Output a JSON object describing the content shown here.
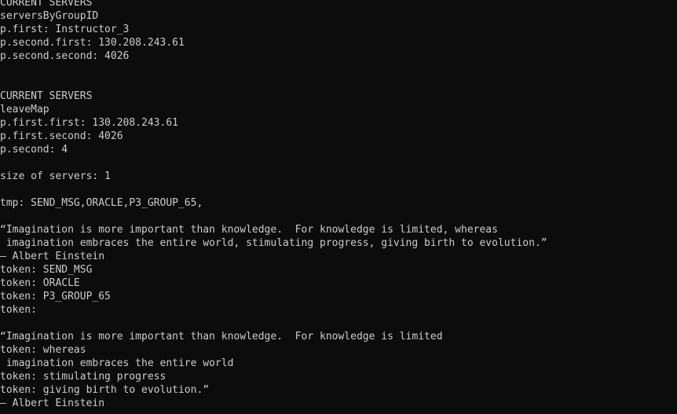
{
  "console": {
    "lines": [
      "CURRENT SERVERS",
      "serversByGroupID",
      "p.first: Instructor_3",
      "p.second.first: 130.208.243.61",
      "p.second.second: 4026",
      "",
      "",
      "CURRENT SERVERS",
      "leaveMap",
      "p.first.first: 130.208.243.61",
      "p.first.second: 4026",
      "p.second: 4",
      "",
      "size of servers: 1",
      "",
      "tmp: SEND_MSG,ORACLE,P3_GROUP_65,",
      "",
      "“Imagination is more important than knowledge.  For knowledge is limited, whereas",
      " imagination embraces the entire world, stimulating progress, giving birth to evolution.”",
      "— Albert Einstein",
      "token: SEND_MSG",
      "token: ORACLE",
      "token: P3_GROUP_65",
      "token: ",
      "",
      "“Imagination is more important than knowledge.  For knowledge is limited",
      "token: whereas",
      " imagination embraces the entire world",
      "token: stimulating progress",
      "token: giving birth to evolution.”",
      "— Albert Einstein"
    ]
  }
}
